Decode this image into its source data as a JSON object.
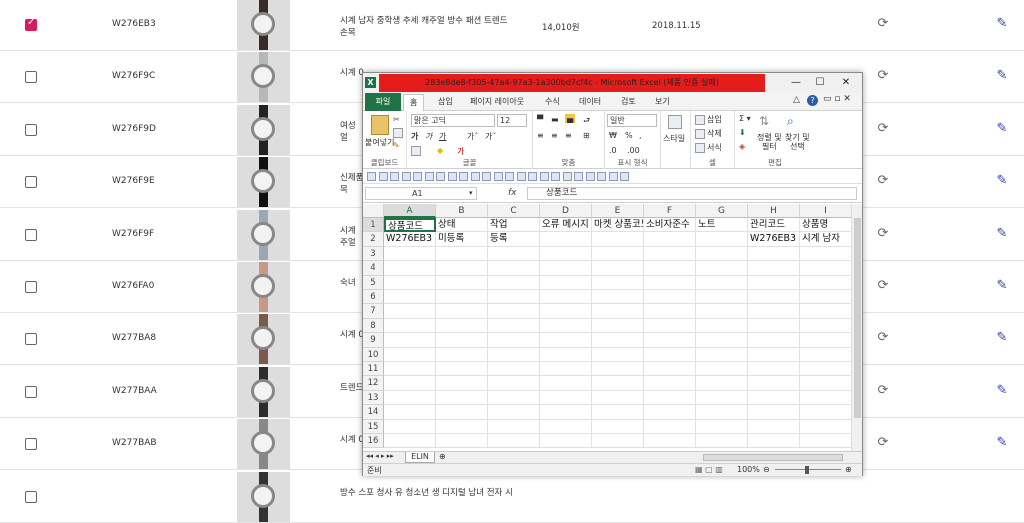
{
  "rows": [
    {
      "checked": true,
      "code": "W276EB3",
      "name": "시계 남자 중학생 추세 캐주얼 방수 패션 트렌드\n손목",
      "price": "14,010원",
      "date": "2018.11.15",
      "strap": "#3a2a2a"
    },
    {
      "checked": false,
      "code": "W276F9C",
      "name": "시계 0",
      "price": "",
      "date": "",
      "strap": "#b8b8b8"
    },
    {
      "checked": false,
      "code": "W276F9D",
      "name": "여성 \n얼",
      "price": "",
      "date": "",
      "strap": "#222"
    },
    {
      "checked": false,
      "code": "W276F9E",
      "name": "신제품\n목",
      "price": "",
      "date": "",
      "strap": "#111"
    },
    {
      "checked": false,
      "code": "W276F9F",
      "name": "시계 \n주얼",
      "price": "",
      "date": "",
      "strap": "#9aa7b5"
    },
    {
      "checked": false,
      "code": "W276FA0",
      "name": "숙녀 ",
      "price": "",
      "date": "",
      "strap": "#c89a84"
    },
    {
      "checked": false,
      "code": "W277BA8",
      "name": "시계 0",
      "price": "",
      "date": "",
      "strap": "#7a5a4e"
    },
    {
      "checked": false,
      "code": "W277BAA",
      "name": "트렌드",
      "price": "",
      "date": "",
      "strap": "#2c2c2c"
    },
    {
      "checked": false,
      "code": "W277BAB",
      "name": "시계 0",
      "price": "",
      "date": "",
      "strap": "#888"
    },
    {
      "checked": false,
      "code": "",
      "name": "방수 스포 청사 유 청소년 생 디지털 남녀 전자 시",
      "price": "",
      "date": "",
      "strap": "#333"
    }
  ],
  "excel": {
    "title": "283e8de8-f305-47a4-97a3-1a300bd7cf4c - Microsoft Excel (제품 인증 실패)",
    "tabs": [
      "파일",
      "홈",
      "삽입",
      "페이지 레이아웃",
      "수식",
      "데이터",
      "검토",
      "보기"
    ],
    "ribbon": {
      "paste": "붙여넣기",
      "clipboard": "클립보드",
      "font_name": "맑은 고딕",
      "font_size": "12",
      "font_group": "글꼴",
      "align_group": "맞춤",
      "number_format": "일반",
      "number_group": "표시 형식",
      "style": "스타일",
      "insert": "삽입",
      "delete": "삭제",
      "format": "서식",
      "cells_group": "셀",
      "sort_filter": "정렬 및\n필터",
      "find_select": "찾기 및\n선택",
      "edit_group": "편집"
    },
    "name_box": "A1",
    "fx": "fx",
    "formula_value": "상품코드",
    "columns": [
      "A",
      "B",
      "C",
      "D",
      "E",
      "F",
      "G",
      "H",
      "I"
    ],
    "row_numbers": [
      "1",
      "2",
      "3",
      "4",
      "5",
      "6",
      "7",
      "8",
      "9",
      "10",
      "11",
      "12",
      "13",
      "14",
      "15",
      "16"
    ],
    "cells": [
      [
        "상품코드",
        "상태",
        "작업",
        "오류 메시지",
        "마켓 상품코드",
        "소비자준수",
        "노트",
        "관리코드",
        "상품명"
      ],
      [
        "W276EB3",
        "미등록",
        "등록",
        "",
        "",
        "",
        "",
        "W276EB3",
        "시계 남자"
      ]
    ],
    "sheet_tab": "ELIN",
    "status": "준비",
    "zoom": "100%"
  }
}
